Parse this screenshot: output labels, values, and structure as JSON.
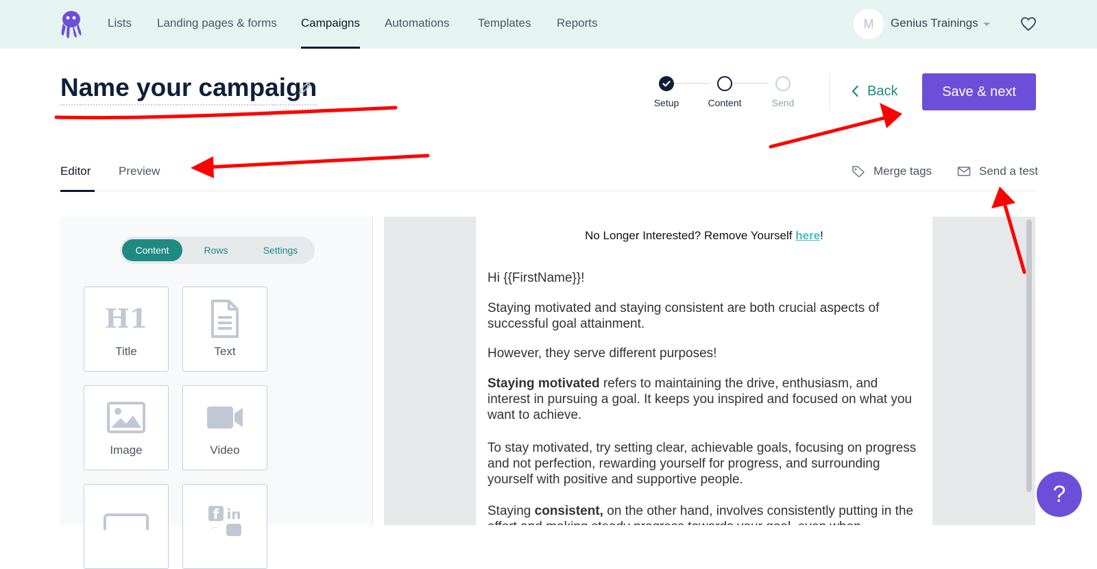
{
  "nav": {
    "items": [
      "Lists",
      "Landing pages & forms",
      "Campaigns",
      "Automations",
      "Templates",
      "Reports"
    ],
    "active": "Campaigns",
    "avatar_letter": "M",
    "account_name": "Genius Trainings"
  },
  "header": {
    "title": "Name your campaign",
    "steps": [
      {
        "label": "Setup",
        "state": "done"
      },
      {
        "label": "Content",
        "state": "current"
      },
      {
        "label": "Send",
        "state": "upcoming"
      }
    ],
    "back_label": "Back",
    "save_label": "Save & next"
  },
  "tabs": {
    "items": [
      "Editor",
      "Preview"
    ],
    "active": "Editor",
    "merge_tags": "Merge tags",
    "send_test": "Send a test"
  },
  "panel": {
    "segments": [
      "Content",
      "Rows",
      "Settings"
    ],
    "active_segment": "Content",
    "blocks": [
      {
        "label": "Title",
        "icon": "h1-icon"
      },
      {
        "label": "Text",
        "icon": "document-icon"
      },
      {
        "label": "Image",
        "icon": "image-icon"
      },
      {
        "label": "Video",
        "icon": "video-icon"
      },
      {
        "label": "",
        "icon": "button-icon"
      },
      {
        "label": "",
        "icon": "social-icon"
      }
    ]
  },
  "email": {
    "unsub_prefix": "No Longer Interested? Remove Yourself ",
    "unsub_link": "here",
    "unsub_suffix": "!",
    "greeting": "Hi {{FirstName}}!",
    "p1": "Staying motivated and staying consistent are both crucial aspects of successful goal attainment.",
    "p2": "However, they serve different purposes!",
    "p3_bold": "Staying motivated",
    "p3_rest": " refers to maintaining the drive, enthusiasm, and interest in pursuing a goal. It keeps you inspired and focused on what you want to achieve.",
    "p4": "To stay motivated, try setting clear, achievable goals, focusing on progress and not perfection, rewarding yourself for progress, and surrounding yourself with positive and supportive people.",
    "p5_start": "Staying ",
    "p5_bold": "consistent,",
    "p5_rest": " on the other hand, involves consistently putting in the effort and making steady progress towards your goal, even when"
  },
  "help": {
    "label": "?"
  },
  "colors": {
    "brand": "#6c4fd8",
    "teal": "#1f8a82",
    "annotation": "#ff0000"
  }
}
